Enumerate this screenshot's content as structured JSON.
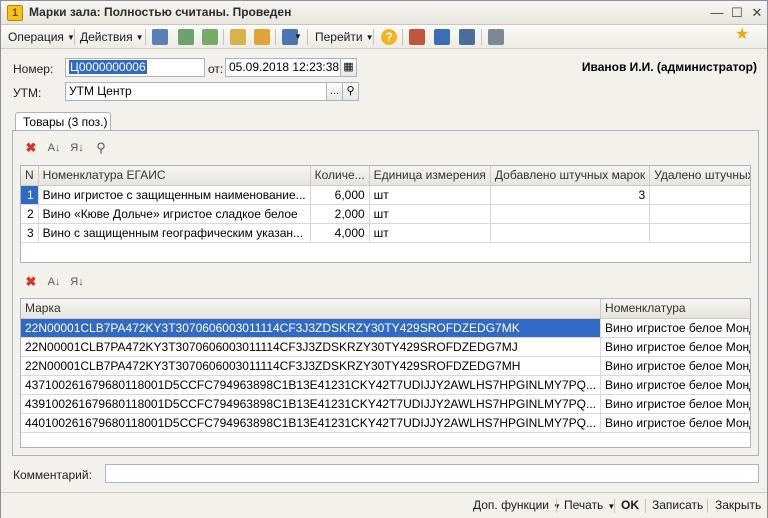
{
  "window": {
    "title": "Марки зала: Полностью считаны. Проведен",
    "app_icon_glyph": "1"
  },
  "toolbar": {
    "operation": "Операция",
    "actions": "Действия",
    "goto": "Перейти"
  },
  "form": {
    "number_label": "Номер:",
    "number_value": "Ц0000000006",
    "date_label": "от:",
    "date_value": "05.09.2018 12:23:38",
    "utm_label": "УТМ:",
    "utm_value": "УТМ Центр",
    "user": "Иванов И.И. (администратор)",
    "comment_label": "Комментарий:",
    "comment_value": ""
  },
  "tab": {
    "label": "Товары (3 поз.)"
  },
  "goods_table": {
    "columns": [
      "N",
      "Номенклатура ЕГАИС",
      "Количе...",
      "Единица измерения",
      "Добавлено штучных марок",
      "Удалено штучных марок"
    ],
    "rows": [
      {
        "n": "1",
        "name": "Вино игристое с защищенным наименование...",
        "qty": "6,000",
        "unit": "шт",
        "added": "3",
        "removed": ""
      },
      {
        "n": "2",
        "name": "Вино «Кюве Дольче» игристое сладкое белое",
        "qty": "2,000",
        "unit": "шт",
        "added": "",
        "removed": ""
      },
      {
        "n": "3",
        "name": "Вино с защищенным географическим указан...",
        "qty": "4,000",
        "unit": "шт",
        "added": "",
        "removed": ""
      }
    ]
  },
  "marks_table": {
    "columns": [
      "Марка",
      "Номенклатура"
    ],
    "rows": [
      {
        "mark": "22N00001CLB7PA472KY3T3070606003011114CF3J3ZDSKRZY30TY429SROFDZEDG7MK",
        "name": "Вино игристое белое Мондоро Асти"
      },
      {
        "mark": "22N00001CLB7PA472KY3T3070606003011114CF3J3ZDSKRZY30TY429SROFDZEDG7MJ",
        "name": "Вино игристое белое Мондоро Асти"
      },
      {
        "mark": "22N00001CLB7PA472KY3T3070606003011114CF3J3ZDSKRZY30TY429SROFDZEDG7MH",
        "name": "Вино игристое белое Мондоро Асти"
      },
      {
        "mark": "437100261679680118001D5CCFC794963898C1B13E41231CKY42T7UDIJJY2AWLHS7HPGINLMY7PQ...",
        "name": "Вино игристое белое Мондоро Асти"
      },
      {
        "mark": "439100261679680118001D5CCFC794963898C1B13E41231CKY42T7UDIJJY2AWLHS7HPGINLMY7PQ...",
        "name": "Вино игристое белое Мондоро Асти"
      },
      {
        "mark": "440100261679680118001D5CCFC794963898C1B13E41231CKY42T7UDIJJY2AWLHS7HPGINLMY7PQ...",
        "name": "Вино игристое белое Мондоро Асти"
      }
    ]
  },
  "bottom": {
    "extra": "Доп. функции",
    "print": "Печать",
    "ok": "OK",
    "save": "Записать",
    "close": "Закрыть"
  },
  "colors": {
    "selection": "#316ac5",
    "delete_icon": "#d9342b"
  }
}
